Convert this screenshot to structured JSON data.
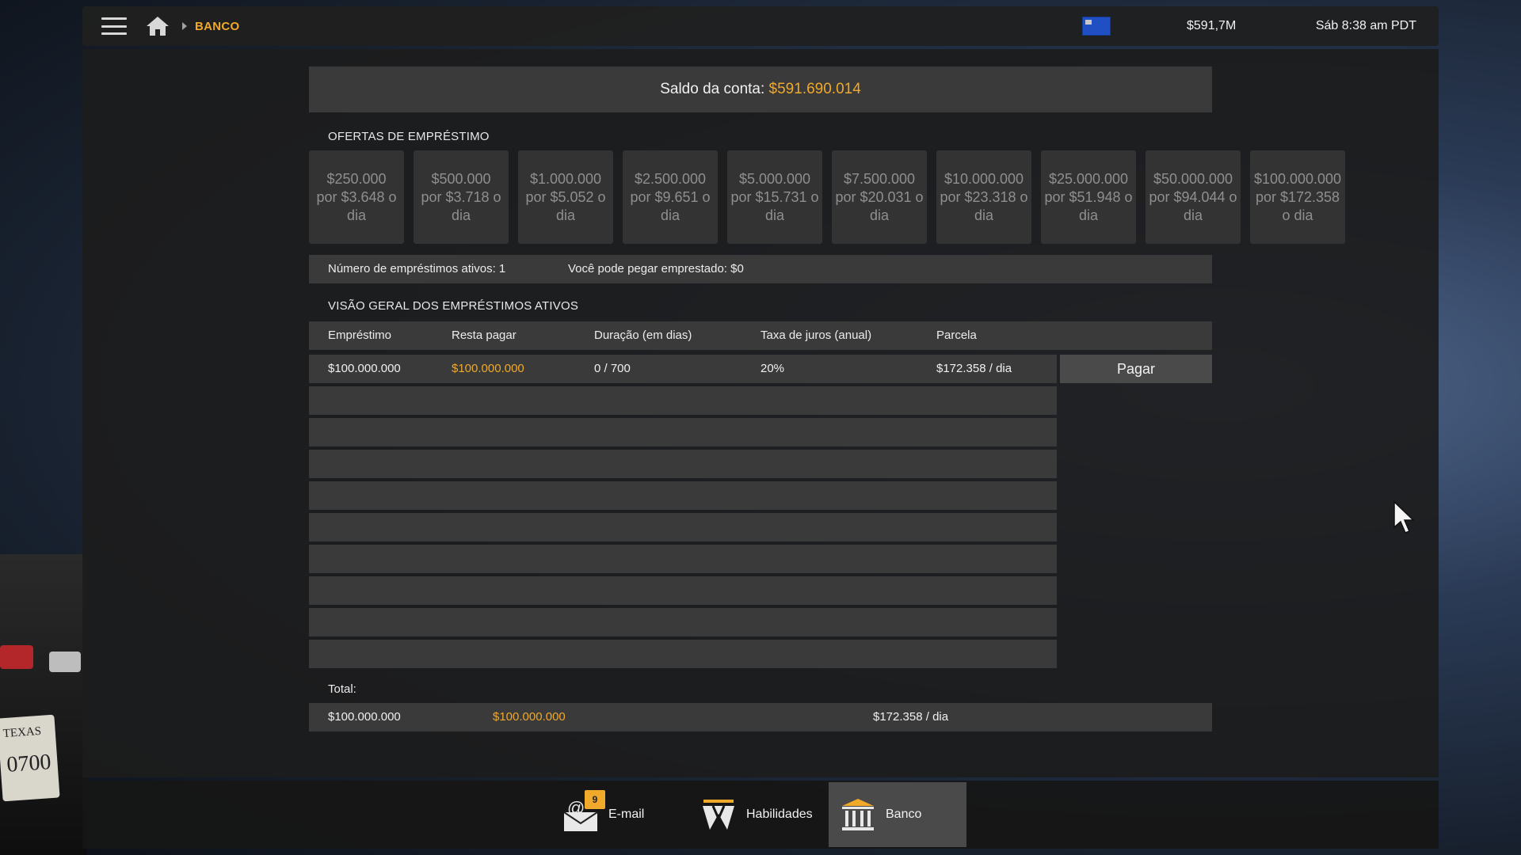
{
  "topbar": {
    "breadcrumb": "BANCO",
    "money": "$591,7M",
    "time": "Sáb 8:38 am PDT"
  },
  "balance": {
    "label": "Saldo da conta:",
    "value": "$591.690.014"
  },
  "offers": {
    "title": "OFERTAS DE EMPRÉSTIMO",
    "items": [
      {
        "amount": "$250.000",
        "rate": "por $3.648 o dia"
      },
      {
        "amount": "$500.000",
        "rate": "por $3.718 o dia"
      },
      {
        "amount": "$1.000.000",
        "rate": "por $5.052 o dia"
      },
      {
        "amount": "$2.500.000",
        "rate": "por $9.651 o dia"
      },
      {
        "amount": "$5.000.000",
        "rate": "por $15.731 o dia"
      },
      {
        "amount": "$7.500.000",
        "rate": "por $20.031 o dia"
      },
      {
        "amount": "$10.000.000",
        "rate": "por $23.318 o dia"
      },
      {
        "amount": "$25.000.000",
        "rate": "por $51.948 o dia"
      },
      {
        "amount": "$50.000.000",
        "rate": "por $94.044 o dia"
      },
      {
        "amount": "$100.000.000",
        "rate": "por $172.358 o dia"
      }
    ]
  },
  "info": {
    "active_loans": "Número de empréstimos ativos: 1",
    "can_borrow": "Você pode pegar emprestado: $0"
  },
  "overview": {
    "title": "VISÃO GERAL DOS EMPRÉSTIMOS ATIVOS",
    "headers": {
      "loan": "Empréstimo",
      "remaining": "Resta pagar",
      "duration": "Duração (em dias)",
      "interest": "Taxa de juros (anual)",
      "installment": "Parcela"
    },
    "rows": [
      {
        "loan": "$100.000.000",
        "remaining": "$100.000.000",
        "duration": "0 / 700",
        "interest": "20%",
        "installment": "$172.358 / dia",
        "pay_label": "Pagar"
      }
    ]
  },
  "total": {
    "label": "Total:",
    "loan": "$100.000.000",
    "remaining": "$100.000.000",
    "installment": "$172.358 / dia"
  },
  "dock": {
    "email_label": "E-mail",
    "email_badge": "9",
    "skills_label": "Habilidades",
    "bank_label": "Banco"
  },
  "colors": {
    "accent": "#f0a92a",
    "row_bg": "#3a3a3a",
    "panel_bg": "#1c1c1c"
  }
}
